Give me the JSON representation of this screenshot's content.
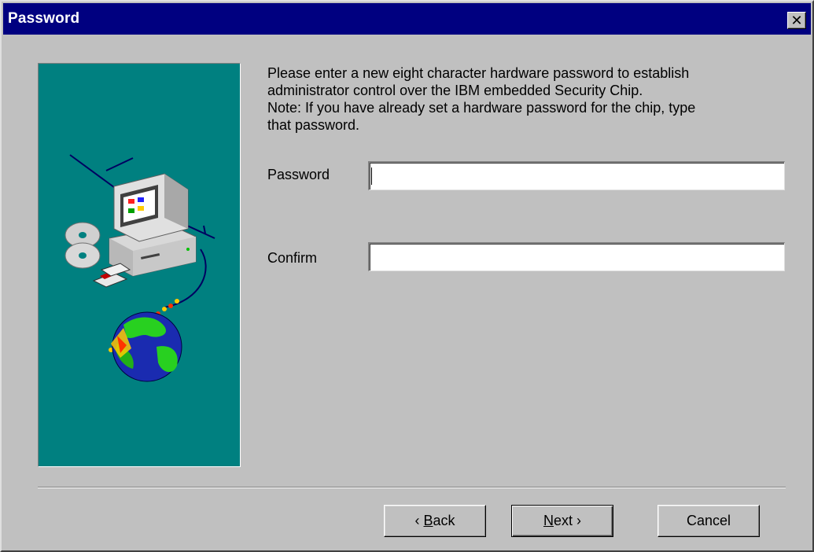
{
  "window": {
    "title": "Password",
    "close_glyph": "✕"
  },
  "instructions": {
    "lines": [
      "Please enter a new eight character hardware password to establish",
      "administrator control over the IBM embedded Security Chip.",
      "Note:  If you have already set a hardware password for the chip, type",
      "that password."
    ]
  },
  "fields": {
    "password": {
      "label": "Password",
      "value": ""
    },
    "confirm": {
      "label": "Confirm",
      "value": ""
    }
  },
  "buttons": {
    "back": {
      "arrow": "‹",
      "accel": "B",
      "rest": "ack"
    },
    "next": {
      "accel": "N",
      "rest": "ext",
      "arrow": "›"
    },
    "cancel": {
      "label": "Cancel"
    }
  },
  "illustration": {
    "icons": [
      "computer-icon",
      "cd-disc-icon",
      "floppy-disk-icon",
      "globe-icon"
    ],
    "panel_color": "#008080"
  }
}
